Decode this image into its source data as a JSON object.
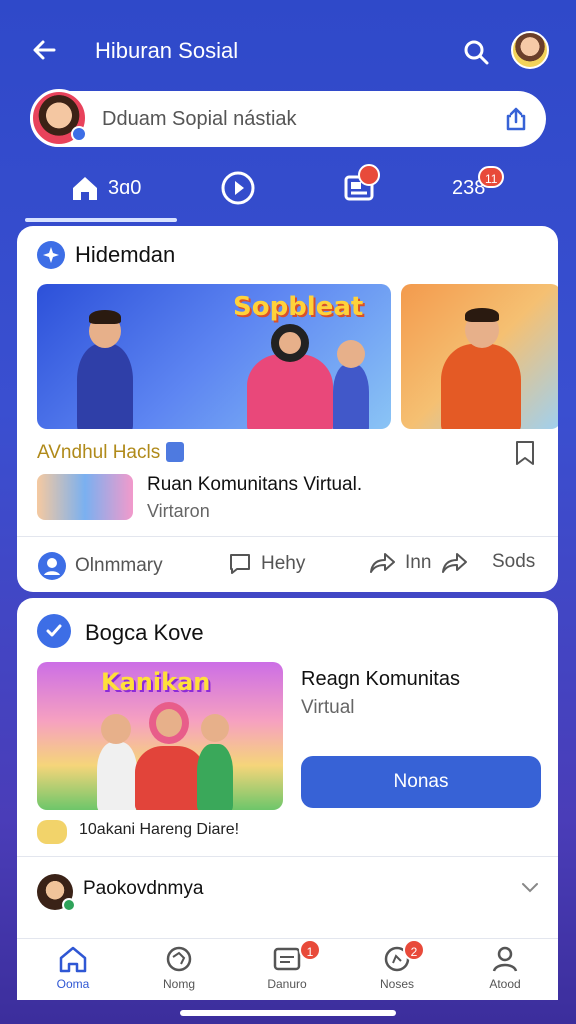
{
  "header": {
    "title": "Hiburan Sosial"
  },
  "search": {
    "placeholder": "Dduam Sopial nástiak"
  },
  "tabs": [
    {
      "label": "3ɑ0"
    },
    {
      "label": ""
    },
    {
      "label": "",
      "badge": "11"
    },
    {
      "label": "238",
      "badge": "11"
    }
  ],
  "card1": {
    "title": "Hidemdan",
    "banner_text": "Sopbleat",
    "highlight_label": "AVndhul Hacls",
    "room_title": "Ruan Komunitans Virtual.",
    "room_sub": "Virtaron",
    "actions": {
      "comment": "Olnmmary",
      "help": "Hehy",
      "share": "Inn",
      "send": "Sods"
    }
  },
  "card2": {
    "title": "Bogca Kove",
    "banner_text": "Kanikan",
    "side_title": "Reagn Komunitas",
    "side_sub": "Virtual",
    "button_label": "Nonas",
    "vote_text": "10akani Hareng Diare!",
    "poster_name": "Paokovdnmya"
  },
  "bottom_nav": [
    {
      "label": "Ooma",
      "active": true
    },
    {
      "label": "Nomg"
    },
    {
      "label": "Danuro",
      "badge": "1"
    },
    {
      "label": "Noses",
      "badge": "2"
    },
    {
      "label": "Atood"
    }
  ],
  "colors": {
    "accent": "#3762d6",
    "badge": "#e84a3a",
    "background": "#3a4fd0"
  }
}
